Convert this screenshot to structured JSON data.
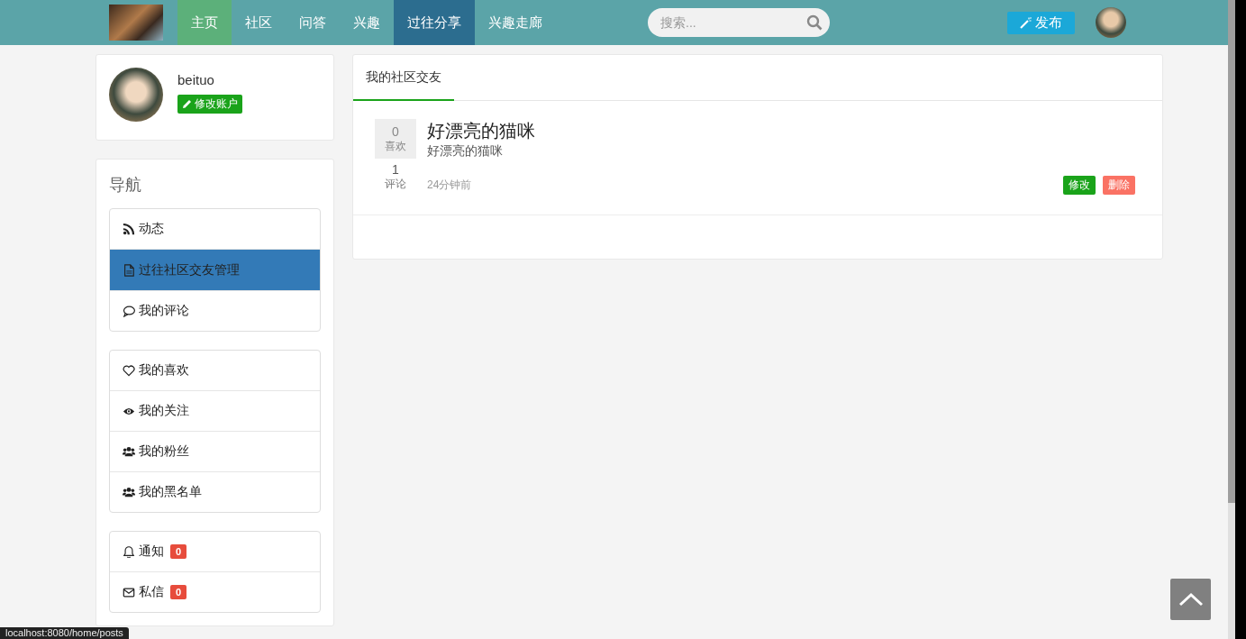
{
  "navbar": {
    "items": [
      {
        "label": "主页",
        "selected": false,
        "hovered": true
      },
      {
        "label": "社区",
        "selected": false,
        "hovered": false
      },
      {
        "label": "问答",
        "selected": false,
        "hovered": false
      },
      {
        "label": "兴趣",
        "selected": false,
        "hovered": false
      },
      {
        "label": "过往分享",
        "selected": true,
        "hovered": false
      },
      {
        "label": "兴趣走廊",
        "selected": false,
        "hovered": false
      }
    ],
    "search": {
      "placeholder": "搜索..."
    },
    "publish_button": "发布"
  },
  "profile": {
    "username": "beituo",
    "edit_button": "修改账户"
  },
  "sidebar": {
    "title": "导航",
    "groups": [
      [
        {
          "label": "动态",
          "selected": false
        },
        {
          "label": "过往社区交友管理",
          "selected": true
        },
        {
          "label": "我的评论",
          "selected": false
        }
      ],
      [
        {
          "label": "我的喜欢",
          "selected": false
        },
        {
          "label": "我的关注",
          "selected": false
        },
        {
          "label": "我的粉丝",
          "selected": false
        },
        {
          "label": "我的黑名单",
          "selected": false
        }
      ],
      [
        {
          "label": "通知",
          "selected": false,
          "badge": "0"
        },
        {
          "label": "私信",
          "selected": false,
          "badge": "0"
        }
      ]
    ]
  },
  "panel": {
    "tabs": [
      {
        "label": "我的社区交友",
        "selected": true
      }
    ],
    "posts": [
      {
        "likes": "0",
        "likes_label": "喜欢",
        "comments": "1",
        "comments_label": "评论",
        "title": "好漂亮的猫咪",
        "summary": "好漂亮的猫咪",
        "time": "24分钟前",
        "edit_button": "修改",
        "delete_button": "删除"
      }
    ]
  },
  "status_url": "localhost:8080/home/posts"
}
